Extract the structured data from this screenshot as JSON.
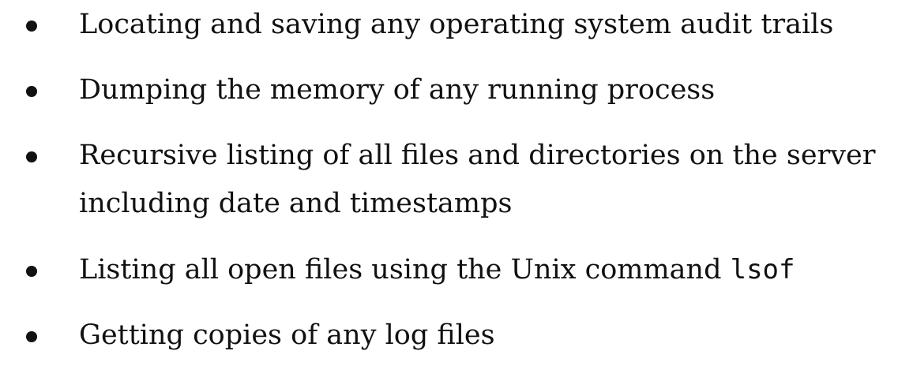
{
  "list": {
    "items": [
      {
        "text": "Locating and saving any operating system audit trails"
      },
      {
        "text": "Dumping the memory of any running process"
      },
      {
        "line1": "Recursive listing of all files and directories on the server",
        "line2": "including date and timestamps"
      },
      {
        "text": "Listing all open files using the Unix command ",
        "code": "lsof"
      },
      {
        "text": "Getting copies of any log files"
      }
    ]
  }
}
